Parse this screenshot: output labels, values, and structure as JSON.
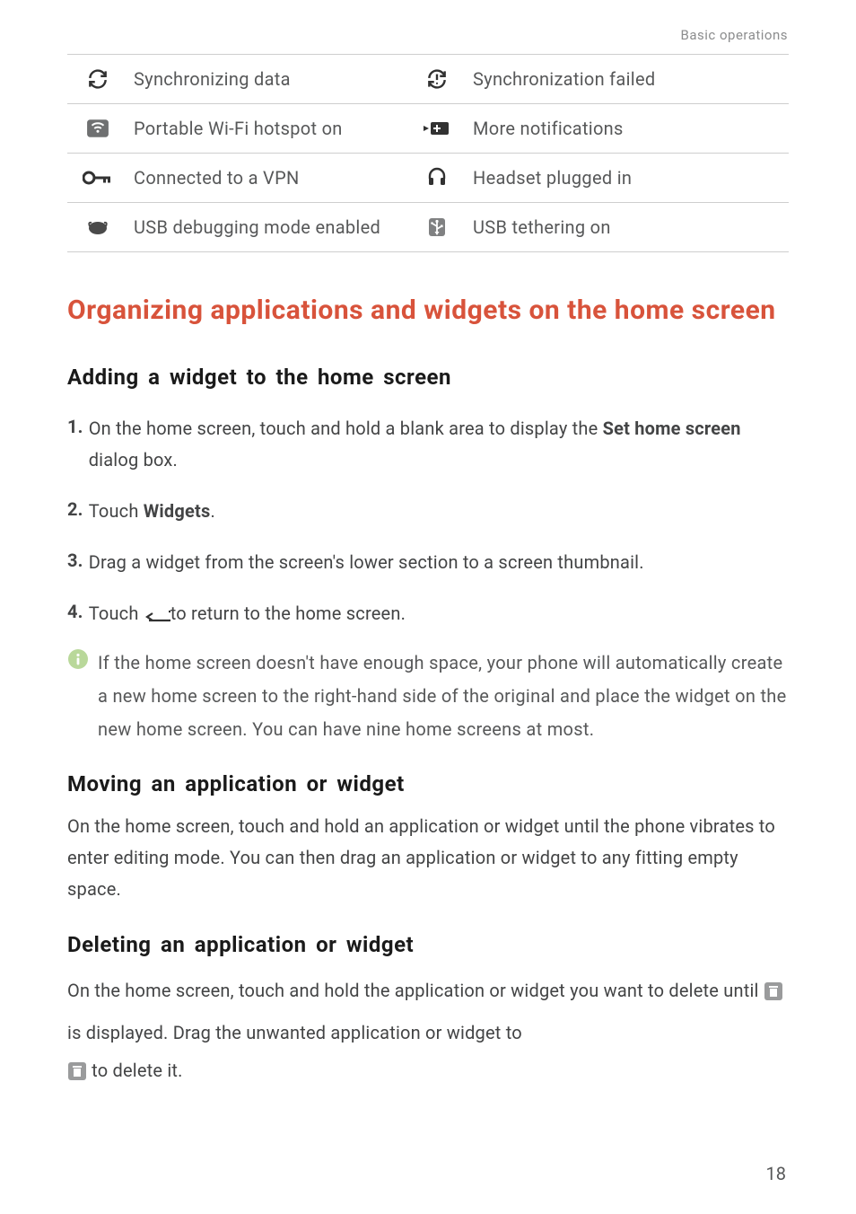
{
  "header": {
    "section": "Basic operations"
  },
  "iconTable": {
    "rows": [
      {
        "left": "Synchronizing data",
        "right": "Synchronization failed"
      },
      {
        "left": "Portable Wi-Fi hotspot on",
        "right": "More notifications"
      },
      {
        "left": "Connected to a VPN",
        "right": "Headset plugged in"
      },
      {
        "left": "USB debugging mode enabled",
        "right": "USB tethering on"
      }
    ]
  },
  "title": "Organizing applications and widgets on the home screen",
  "sections": {
    "adding": {
      "heading": "Adding a widget to the home screen",
      "step1_pre": "On the home screen, touch and hold a blank area to display the ",
      "step1_bold": "Set home screen",
      "step1_post": " dialog box.",
      "step2_pre": "Touch ",
      "step2_bold": "Widgets",
      "step2_post": ".",
      "step3": "Drag a widget from the screen's lower section to a screen thumbnail.",
      "step4_pre": "Touch ",
      "step4_post": "to return to the home screen.",
      "info": "If the home screen doesn't have enough space, your phone will automatically create a new home screen to the right-hand side of the original and place the widget on the new home screen. You can have nine home screens at most."
    },
    "moving": {
      "heading": "Moving an application or widget",
      "para": "On the home screen, touch and hold an application or widget until the phone vibrates to enter editing mode. You can then drag an application or widget to any fitting empty space."
    },
    "deleting": {
      "heading": "Deleting an application or widget",
      "line1_pre": "On the home screen, touch and hold the application or widget you want to ",
      "line2_pre": "delete until ",
      "line2_post": " is displayed. Drag the unwanted application or widget to ",
      "line3_post": " to delete it."
    }
  },
  "steps": {
    "s1": "1.",
    "s2": "2.",
    "s3": "3.",
    "s4": "4."
  },
  "page": "18"
}
